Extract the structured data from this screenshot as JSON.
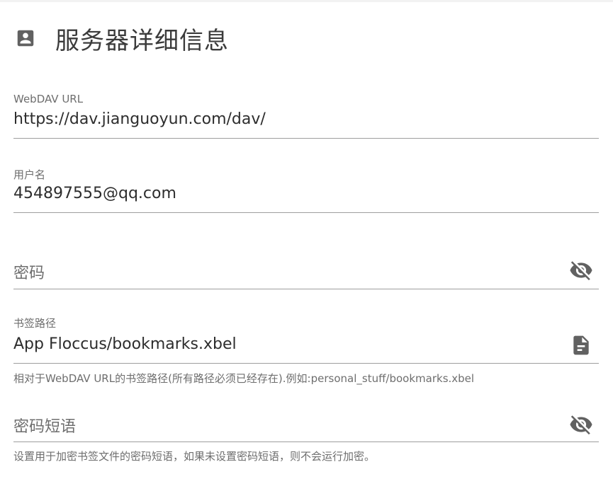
{
  "header": {
    "title": "服务器详细信息",
    "icon": "account-box-icon"
  },
  "fields": {
    "webdav_url": {
      "label": "WebDAV URL",
      "value": "https://dav.jianguoyun.com/dav/"
    },
    "username": {
      "label": "用户名",
      "value": "454897555@qq.com"
    },
    "password": {
      "placeholder": "密码",
      "value": "",
      "icon": "eye-off-icon"
    },
    "bookmark_path": {
      "label": "书签路径",
      "value": "App Floccus/bookmarks.xbel",
      "hint": "相对于WebDAV URL的书签路径(所有路径必须已经存在).例如:personal_stuff/bookmarks.xbel",
      "icon": "file-document-icon"
    },
    "passphrase": {
      "placeholder": "密码短语",
      "value": "",
      "hint": "设置用于加密书签文件的密码短语，如果未设置密码短语，则不会运行加密。",
      "icon": "eye-off-icon"
    }
  },
  "colors": {
    "text": "#2d2d2d",
    "label": "#6e6e6e",
    "icon": "#616161",
    "underline": "#9e9e9e"
  }
}
